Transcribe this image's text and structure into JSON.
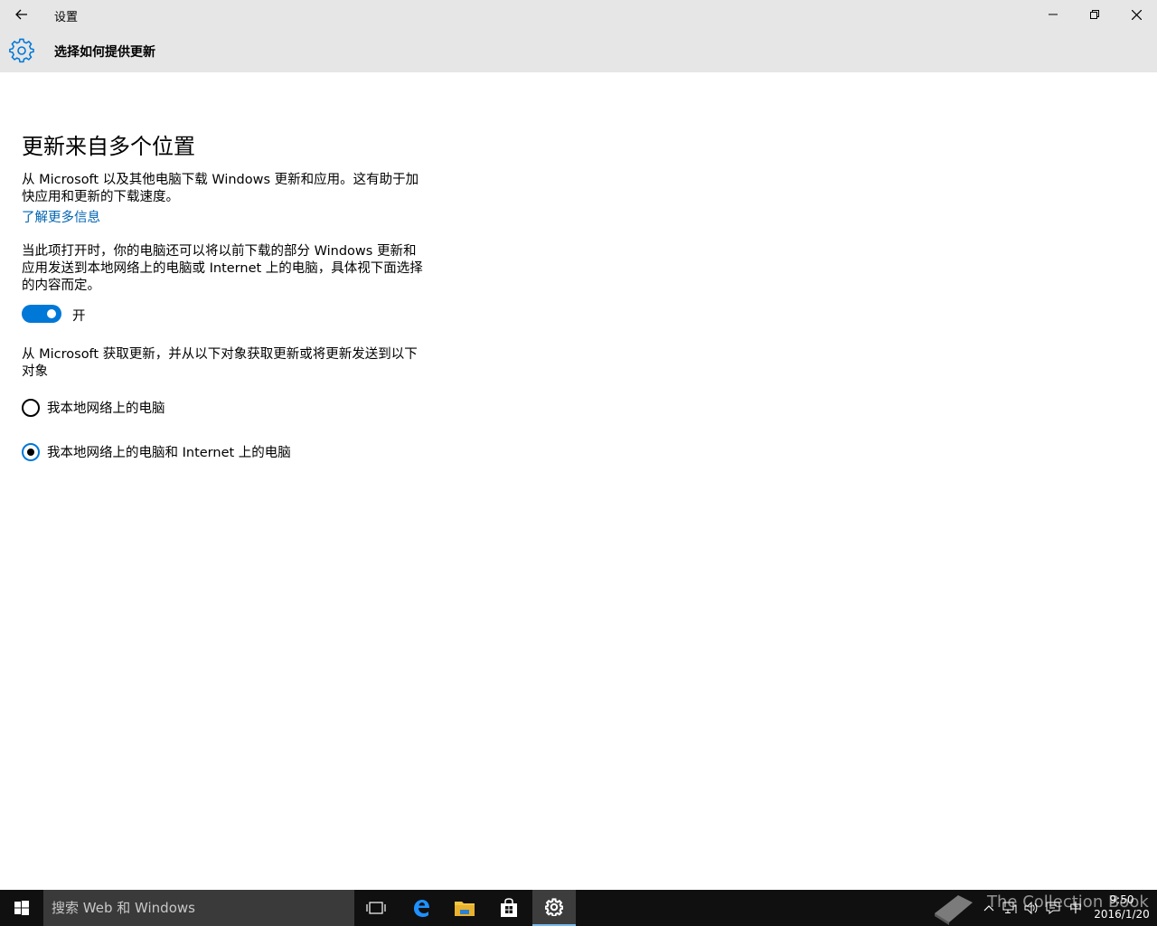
{
  "window": {
    "title": "设置",
    "back_icon": "arrow-left-icon",
    "minimize_icon": "minimize-icon",
    "maximize_icon": "restore-icon",
    "close_icon": "close-icon"
  },
  "header": {
    "icon": "gear-icon",
    "title": "选择如何提供更新"
  },
  "main": {
    "heading": "更新来自多个位置",
    "para1": "从 Microsoft 以及其他电脑下载 Windows 更新和应用。这有助于加快应用和更新的下载速度。",
    "learn_more": "了解更多信息",
    "para2": "当此项打开时，你的电脑还可以将以前下载的部分 Windows 更新和应用发送到本地网络上的电脑或 Internet 上的电脑，具体视下面选择的内容而定。",
    "toggle": {
      "state": "on",
      "label": "开"
    },
    "para3": "从 Microsoft 获取更新，并从以下对象获取更新或将更新发送到以下对象",
    "radio_options": [
      {
        "label": "我本地网络上的电脑",
        "selected": false
      },
      {
        "label": "我本地网络上的电脑和 Internet 上的电脑",
        "selected": true
      }
    ]
  },
  "taskbar": {
    "search_placeholder": "搜索 Web 和 Windows",
    "apps": [
      "task-view-icon",
      "edge-icon",
      "file-explorer-icon",
      "store-icon",
      "settings-icon"
    ],
    "active_app": "settings-icon",
    "tray": {
      "ime": "中",
      "time": "9:50",
      "date": "2016/1/20",
      "watermark": "The Collection Book"
    }
  },
  "colors": {
    "accent": "#0078d7",
    "link": "#0063b1",
    "chrome": "#e6e6e6",
    "taskbar": "#101010"
  }
}
